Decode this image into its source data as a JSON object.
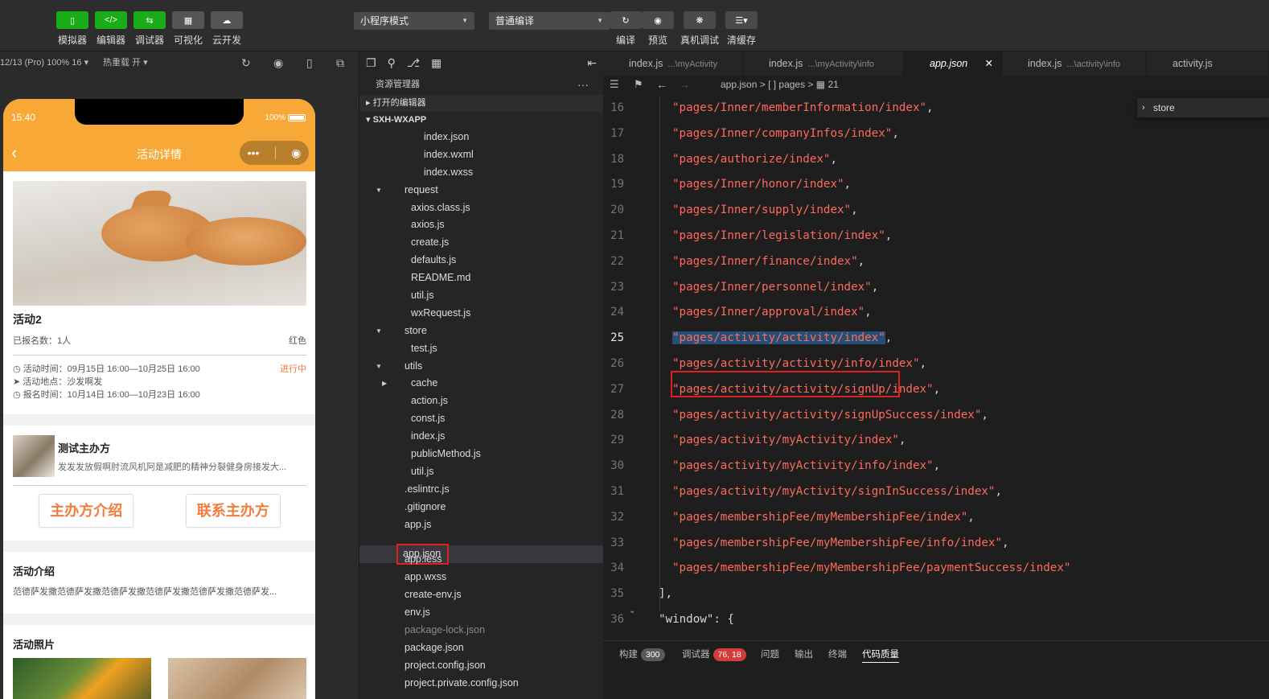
{
  "toolbar": {
    "buttons": [
      {
        "label": "模拟器",
        "icon": "phone-icon",
        "active": true
      },
      {
        "label": "编辑器",
        "icon": "code-icon",
        "active": true
      },
      {
        "label": "调试器",
        "icon": "debug-arrows-icon",
        "active": true
      },
      {
        "label": "可视化",
        "icon": "layout-icon",
        "active": false
      },
      {
        "label": "云开发",
        "icon": "cloud-icon",
        "active": false
      }
    ],
    "mode_select": "小程序模式",
    "compile_select": "普通编译",
    "actions": [
      {
        "label": "编译",
        "icon": "refresh-icon"
      },
      {
        "label": "预览",
        "icon": "eye-icon"
      },
      {
        "label": "真机调试",
        "icon": "bug-icon"
      },
      {
        "label": "清缓存",
        "icon": "layers-icon"
      }
    ]
  },
  "simulator_bar": {
    "device": "12/13 (Pro) 100% 16 ▾",
    "hotreload": "热重载 开 ▾"
  },
  "phone": {
    "time": "15:40",
    "battery": "100%",
    "nav_title": "活动详情",
    "activity_title": "活动2",
    "registered": "已报名数：1人",
    "tag": "红色",
    "time_row": "活动时间：09月15日 16:00—10月25日 16:00",
    "status": "进行中",
    "location_row": "活动地点：沙发啊发",
    "signup_row": "报名时间：10月14日 16:00—10月23日 16:00",
    "organizer_name": "测试主办方",
    "organizer_desc": "发发发放假啊肘流风机阿是减肥的精神分裂健身房接发大...",
    "btn_intro": "主办方介绍",
    "btn_contact": "联系主办方",
    "intro_title": "活动介绍",
    "intro_text": "范德萨发撒范德萨发撒范德萨发撒范德萨发撒范德萨发撒范德萨发...",
    "photos_title": "活动照片"
  },
  "explorer": {
    "title": "资源管理器",
    "more": "···",
    "open_editors": "打开的编辑器",
    "project": "SXH-WXAPP",
    "items": [
      {
        "label": "index.json",
        "indent": 80,
        "arrow": ""
      },
      {
        "label": "index.wxml",
        "indent": 80,
        "arrow": ""
      },
      {
        "label": "index.wxss",
        "indent": 80,
        "arrow": ""
      },
      {
        "label": "request",
        "indent": 56,
        "arrow": "▼"
      },
      {
        "label": "axios.class.js",
        "indent": 64,
        "arrow": ""
      },
      {
        "label": "axios.js",
        "indent": 64,
        "arrow": ""
      },
      {
        "label": "create.js",
        "indent": 64,
        "arrow": ""
      },
      {
        "label": "defaults.js",
        "indent": 64,
        "arrow": ""
      },
      {
        "label": "README.md",
        "indent": 64,
        "arrow": ""
      },
      {
        "label": "util.js",
        "indent": 64,
        "arrow": ""
      },
      {
        "label": "wxRequest.js",
        "indent": 64,
        "arrow": ""
      },
      {
        "label": "store",
        "indent": 56,
        "arrow": "▼"
      },
      {
        "label": "test.js",
        "indent": 64,
        "arrow": ""
      },
      {
        "label": "utils",
        "indent": 56,
        "arrow": "▼"
      },
      {
        "label": "cache",
        "indent": 64,
        "arrow": "▶"
      },
      {
        "label": "action.js",
        "indent": 64,
        "arrow": ""
      },
      {
        "label": "const.js",
        "indent": 64,
        "arrow": ""
      },
      {
        "label": "index.js",
        "indent": 64,
        "arrow": ""
      },
      {
        "label": "publicMethod.js",
        "indent": 64,
        "arrow": ""
      },
      {
        "label": "util.js",
        "indent": 64,
        "arrow": ""
      },
      {
        "label": ".eslintrc.js",
        "indent": 56,
        "arrow": ""
      },
      {
        "label": ".gitignore",
        "indent": 56,
        "arrow": ""
      },
      {
        "label": "app.js",
        "indent": 56,
        "arrow": ""
      },
      {
        "label": "app.json",
        "indent": 56,
        "arrow": "",
        "selected": true
      },
      {
        "label": "app.less",
        "indent": 56,
        "arrow": ""
      },
      {
        "label": "app.wxss",
        "indent": 56,
        "arrow": ""
      },
      {
        "label": "create-env.js",
        "indent": 56,
        "arrow": ""
      },
      {
        "label": "env.js",
        "indent": 56,
        "arrow": ""
      },
      {
        "label": "package-lock.json",
        "indent": 56,
        "arrow": "",
        "dim": true
      },
      {
        "label": "package.json",
        "indent": 56,
        "arrow": ""
      },
      {
        "label": "project.config.json",
        "indent": 56,
        "arrow": ""
      },
      {
        "label": "project.private.config.json",
        "indent": 56,
        "arrow": ""
      }
    ]
  },
  "editor": {
    "tabs": [
      {
        "name": "index.js",
        "path": "...\\myActivity",
        "width": 174
      },
      {
        "name": "index.js",
        "path": "...\\myActivity\\info",
        "width": 200
      },
      {
        "name": "app.json",
        "path": "",
        "width": 122,
        "active": true,
        "close": "✕"
      },
      {
        "name": "index.js",
        "path": "...\\activity\\info",
        "width": 180
      },
      {
        "name": "activity.js",
        "path": "",
        "width": 152
      }
    ],
    "breadcrumb": {
      "file": "app.json",
      "sep1": " > ",
      "arr": "[ ] pages",
      "sep2": " > ",
      "idx": "21"
    },
    "find_text": "store",
    "lines": [
      {
        "n": "16",
        "t": "\"pages/Inner/memberInformation/index\"",
        "p": ","
      },
      {
        "n": "17",
        "t": "\"pages/Inner/companyInfos/index\"",
        "p": ","
      },
      {
        "n": "18",
        "t": "\"pages/authorize/index\"",
        "p": ","
      },
      {
        "n": "19",
        "t": "\"pages/Inner/honor/index\"",
        "p": ","
      },
      {
        "n": "20",
        "t": "\"pages/Inner/supply/index\"",
        "p": ","
      },
      {
        "n": "21",
        "t": "\"pages/Inner/legislation/index\"",
        "p": ","
      },
      {
        "n": "22",
        "t": "\"pages/Inner/finance/index\"",
        "p": ","
      },
      {
        "n": "23",
        "t": "\"pages/Inner/personnel/index\"",
        "p": ","
      },
      {
        "n": "24",
        "t": "\"pages/Inner/approval/index\"",
        "p": ","
      },
      {
        "n": "25",
        "t": "\"pages/activity/activity/index\"",
        "p": ",",
        "current": true
      },
      {
        "n": "26",
        "t": "\"pages/activity/activity/info/index\"",
        "p": ","
      },
      {
        "n": "27",
        "t": "\"pages/activity/activity/signUp/index\"",
        "p": ","
      },
      {
        "n": "28",
        "t": "\"pages/activity/activity/signUpSuccess/index\"",
        "p": ","
      },
      {
        "n": "29",
        "t": "\"pages/activity/myActivity/index\"",
        "p": ","
      },
      {
        "n": "30",
        "t": "\"pages/activity/myActivity/info/index\"",
        "p": ","
      },
      {
        "n": "31",
        "t": "\"pages/activity/myActivity/signInSuccess/index\"",
        "p": ","
      },
      {
        "n": "32",
        "t": "\"pages/membershipFee/myMembershipFee/index\"",
        "p": ","
      },
      {
        "n": "33",
        "t": "\"pages/membershipFee/myMembershipFee/info/index\"",
        "p": ","
      },
      {
        "n": "34",
        "t": "\"pages/membershipFee/myMembershipFee/paymentSuccess/index\"",
        "p": ""
      },
      {
        "n": "35",
        "t": "],",
        "p": "",
        "outdent": true
      },
      {
        "n": "36",
        "t": "\"window\": {",
        "p": "",
        "outdent": true
      }
    ]
  },
  "bottom_panel": {
    "tabs": [
      {
        "label": "构建",
        "badge": "300",
        "badge_color": "gray"
      },
      {
        "label": "调试器",
        "badge": "76, 18",
        "badge_color": "red"
      },
      {
        "label": "问题",
        "badge": ""
      },
      {
        "label": "输出",
        "badge": ""
      },
      {
        "label": "终端",
        "badge": ""
      },
      {
        "label": "代码质量",
        "badge": "",
        "active": true
      }
    ]
  },
  "colors": {
    "accent_green": "#1aad19",
    "phone_orange": "#f7a837",
    "string_red": "#ff6b5b",
    "highlight_red": "#e02020",
    "selection_blue": "#264f78"
  }
}
